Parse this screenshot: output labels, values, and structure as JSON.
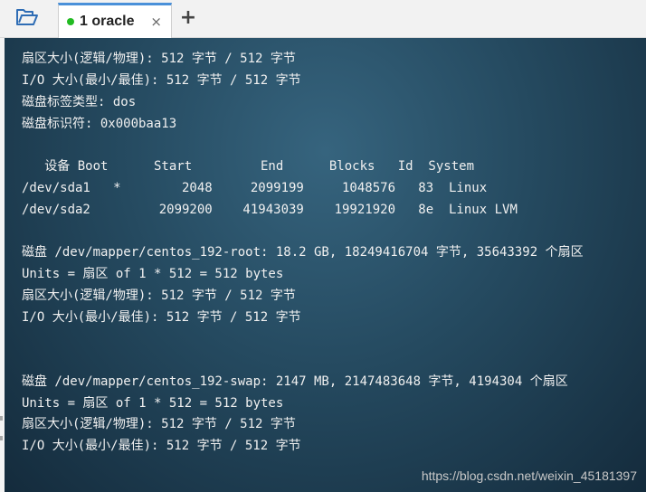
{
  "tab": {
    "label": "1 oracle",
    "close_icon": "×",
    "status_color": "#22bb22"
  },
  "add_tab_label": "+",
  "icons": {
    "folder": "folder-open-icon",
    "close": "close-icon",
    "add": "plus-icon"
  },
  "terminal": {
    "lines": [
      "扇区大小(逻辑/物理): 512 字节 / 512 字节",
      "I/O 大小(最小/最佳): 512 字节 / 512 字节",
      "磁盘标签类型: dos",
      "磁盘标识符: 0x000baa13",
      "",
      "   设备 Boot      Start         End      Blocks   Id  System",
      "/dev/sda1   *        2048     2099199     1048576   83  Linux",
      "/dev/sda2         2099200    41943039    19921920   8e  Linux LVM",
      "",
      "磁盘 /dev/mapper/centos_192-root: 18.2 GB, 18249416704 字节, 35643392 个扇区",
      "Units = 扇区 of 1 * 512 = 512 bytes",
      "扇区大小(逻辑/物理): 512 字节 / 512 字节",
      "I/O 大小(最小/最佳): 512 字节 / 512 字节",
      "",
      "",
      "磁盘 /dev/mapper/centos_192-swap: 2147 MB, 2147483648 字节, 4194304 个扇区",
      "Units = 扇区 of 1 * 512 = 512 bytes",
      "扇区大小(逻辑/物理): 512 字节 / 512 字节",
      "I/O 大小(最小/最佳): 512 字节 / 512 字节"
    ]
  },
  "watermark": "https://blog.csdn.net/weixin_45181397"
}
